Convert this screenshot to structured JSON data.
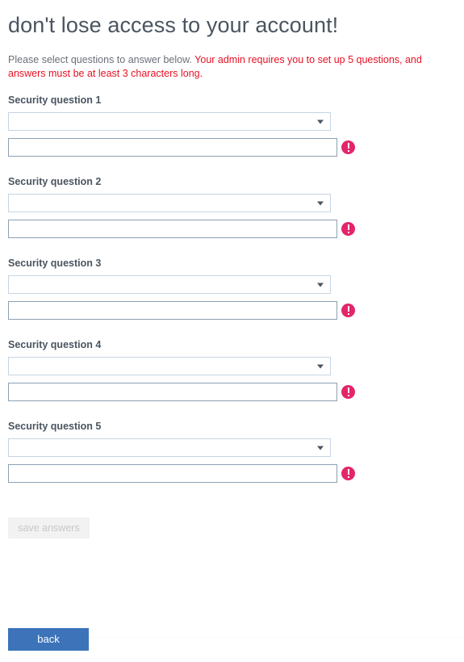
{
  "header": {
    "title": "don't lose access to your account!",
    "instructions_plain": "Please select questions to answer below. ",
    "instructions_warning": "Your admin requires you to set up 5 questions, and answers must be at least 3 characters long.",
    "warning_color": "#e81123"
  },
  "questions": [
    {
      "label": "Security question 1",
      "select_value": "",
      "select_placeholder": "",
      "answer_value": "",
      "answer_placeholder": "",
      "error": true,
      "caret_icon": "chevron-down-icon",
      "error_icon": "error-exclamation-icon"
    },
    {
      "label": "Security question 2",
      "select_value": "",
      "select_placeholder": "",
      "answer_value": "",
      "answer_placeholder": "",
      "error": true,
      "caret_icon": "chevron-down-icon",
      "error_icon": "error-exclamation-icon"
    },
    {
      "label": "Security question 3",
      "select_value": "",
      "select_placeholder": "",
      "answer_value": "",
      "answer_placeholder": "",
      "error": true,
      "caret_icon": "chevron-down-icon",
      "error_icon": "error-exclamation-icon"
    },
    {
      "label": "Security question 4",
      "select_value": "",
      "select_placeholder": "",
      "answer_value": "",
      "answer_placeholder": "",
      "error": true,
      "caret_icon": "chevron-down-icon",
      "error_icon": "error-exclamation-icon"
    },
    {
      "label": "Security question 5",
      "select_value": "",
      "select_placeholder": "",
      "answer_value": "",
      "answer_placeholder": "",
      "error": true,
      "caret_icon": "chevron-down-icon",
      "error_icon": "error-exclamation-icon"
    }
  ],
  "actions": {
    "save_label": "save answers",
    "save_enabled": false,
    "back_label": "back",
    "back_color": "#3c73b9",
    "error_color": "#e3256b"
  }
}
